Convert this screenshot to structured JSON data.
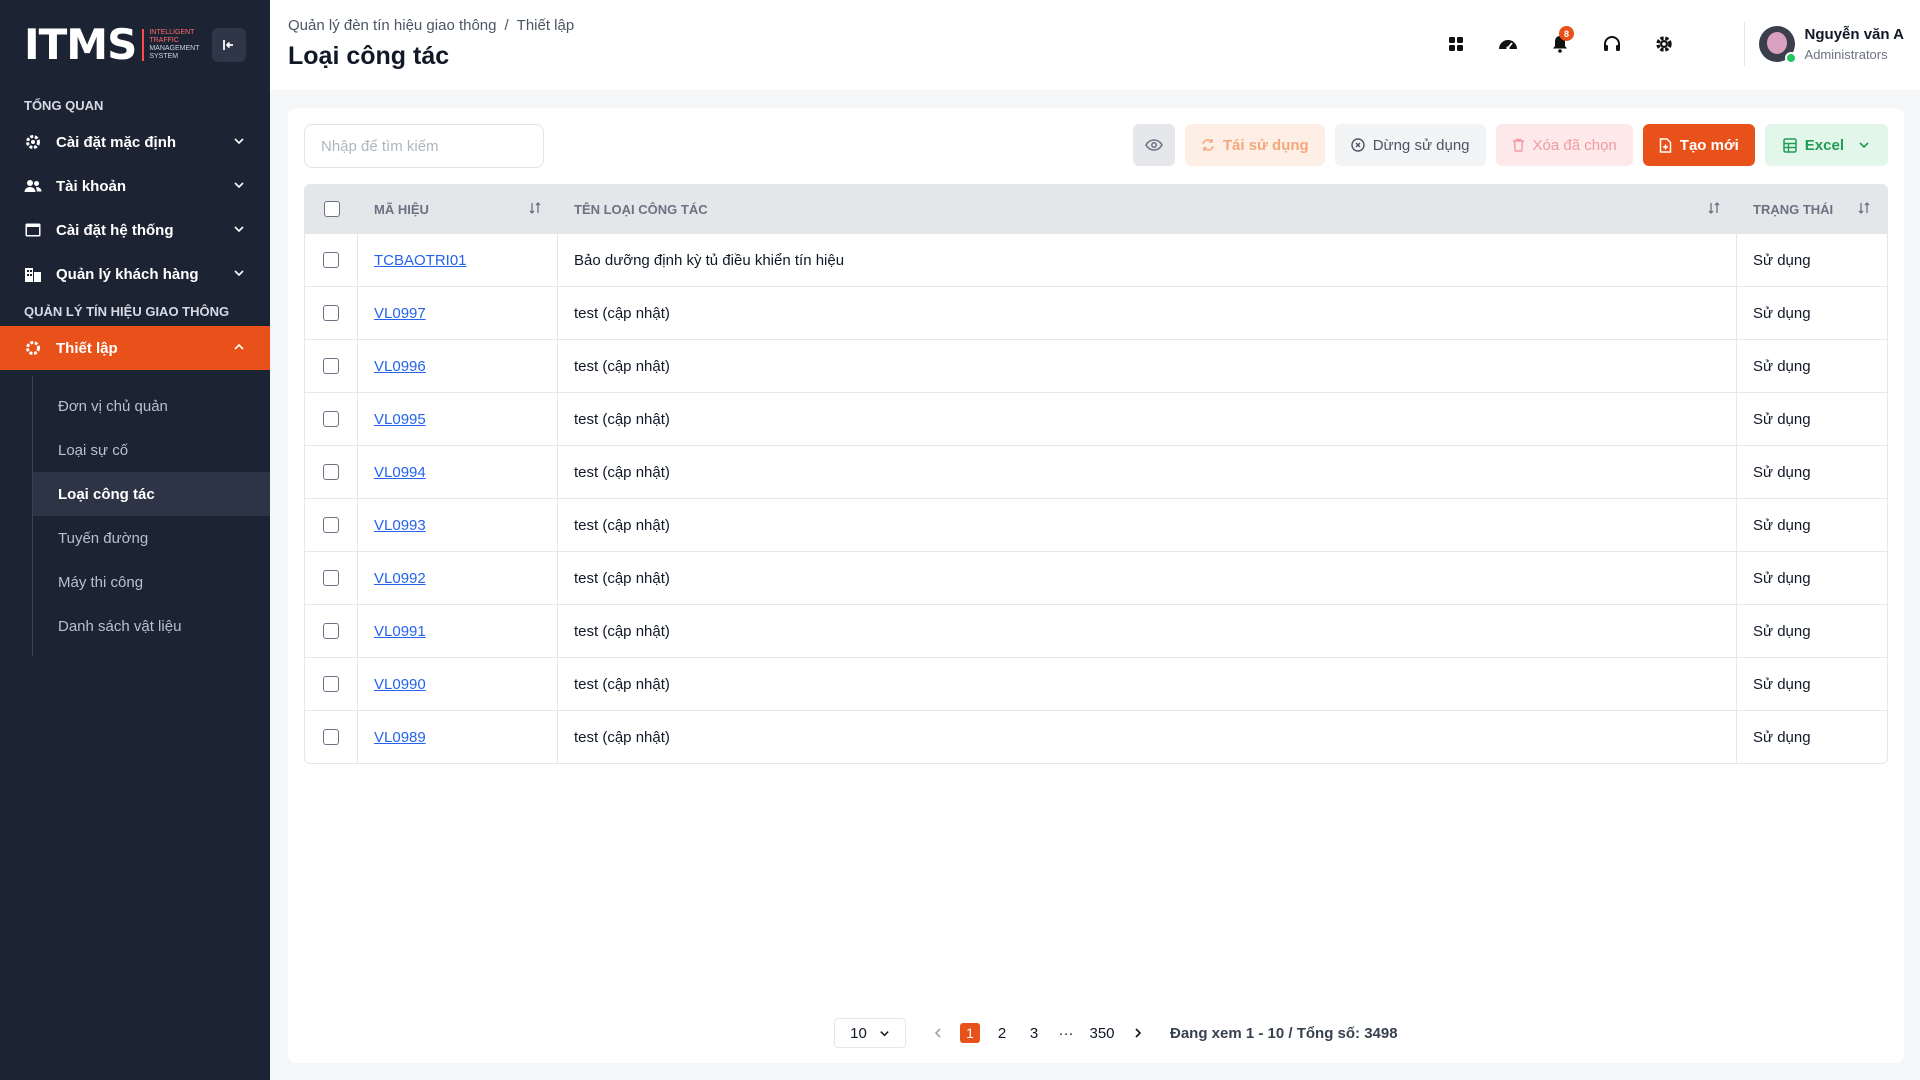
{
  "brand": {
    "logo_main": "ITMS",
    "logo_sub_lines": [
      "INTELLIGENT",
      "TRAFFIC",
      "MANAGEMENT",
      "SYSTEM"
    ]
  },
  "sidebar": {
    "section1": "TỔNG QUAN",
    "items_top": [
      {
        "label": "Cài đặt mặc định",
        "icon": "gear-icon"
      },
      {
        "label": "Tài khoản",
        "icon": "users-icon"
      },
      {
        "label": "Cài đặt hệ thống",
        "icon": "window-icon"
      },
      {
        "label": "Quản lý khách hàng",
        "icon": "building-icon"
      }
    ],
    "section2": "QUẢN LÝ TÍN HIỆU GIAO THÔNG",
    "active_item": "Thiết lập",
    "sub_items": [
      "Đơn vị chủ quản",
      "Loại sự cố",
      "Loại công tác",
      "Tuyến đường",
      "Máy thi công",
      "Danh sách vật liệu"
    ]
  },
  "header": {
    "breadcrumb": [
      "Quản lý đèn tín hiệu giao thông",
      "/",
      "Thiết lập"
    ],
    "title": "Loại công tác",
    "notification_count": "8",
    "user_name": "Nguyễn văn A",
    "user_role": "Administrators"
  },
  "toolbar": {
    "search_placeholder": "Nhập để tìm kiếm",
    "reuse": "Tái sử dụng",
    "stop": "Dừng sử dụng",
    "delete": "Xóa đã chọn",
    "create": "Tạo mới",
    "excel": "Excel"
  },
  "table": {
    "headers": [
      "MÃ HIỆU",
      "TÊN LOẠI CÔNG TÁC",
      "TRẠNG THÁI"
    ],
    "rows": [
      {
        "code": "TCBAOTRI01",
        "name": "Bảo dưỡng định kỳ tủ điều khiển tín hiệu",
        "status": "Sử dụng"
      },
      {
        "code": "VL0997",
        "name": "test (cập nhật)",
        "status": "Sử dụng"
      },
      {
        "code": "VL0996",
        "name": "test (cập nhật)",
        "status": "Sử dụng"
      },
      {
        "code": "VL0995",
        "name": "test (cập nhật)",
        "status": "Sử dụng"
      },
      {
        "code": "VL0994",
        "name": "test (cập nhật)",
        "status": "Sử dụng"
      },
      {
        "code": "VL0993",
        "name": "test (cập nhật)",
        "status": "Sử dụng"
      },
      {
        "code": "VL0992",
        "name": "test (cập nhật)",
        "status": "Sử dụng"
      },
      {
        "code": "VL0991",
        "name": "test (cập nhật)",
        "status": "Sử dụng"
      },
      {
        "code": "VL0990",
        "name": "test (cập nhật)",
        "status": "Sử dụng"
      },
      {
        "code": "VL0989",
        "name": "test (cập nhật)",
        "status": "Sử dụng"
      }
    ]
  },
  "pagination": {
    "page_size": "10",
    "pages": [
      "1",
      "2",
      "3",
      "···",
      "350"
    ],
    "current": "1",
    "info": "Đang xem 1 - 10 / Tổng số: 3498"
  },
  "colors": {
    "accent": "#e8511a",
    "sidebar_bg": "#1c2333",
    "link": "#2563eb"
  }
}
